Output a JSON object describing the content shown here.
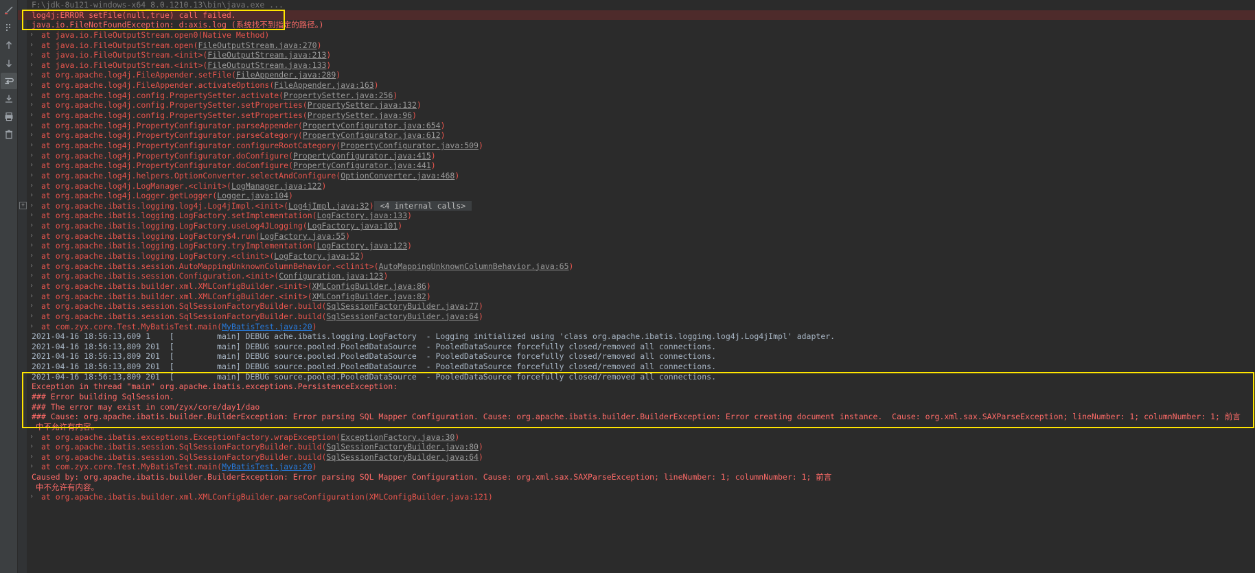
{
  "window": {
    "command_line": "F:\\jdk-8u121-windows-x64_8.0.1210.13\\bin\\java.exe ..."
  },
  "toolbar": {
    "items": [
      {
        "name": "rerun-icon",
        "label": "Rerun"
      },
      {
        "name": "more-options-icon",
        "label": "More"
      },
      {
        "name": "up-arrow-icon",
        "label": "Previous Occurrence"
      },
      {
        "name": "down-arrow-icon",
        "label": "Next Occurrence"
      },
      {
        "name": "soft-wrap-icon",
        "label": "Soft-Wrap"
      },
      {
        "name": "scroll-to-end-icon",
        "label": "Scroll to End"
      },
      {
        "name": "print-icon",
        "label": "Print"
      },
      {
        "name": "clear-all-icon",
        "label": "Clear All"
      }
    ]
  },
  "console": {
    "lines": [
      {
        "kind": "title",
        "text": "F:\\jdk-8u121-windows-x64_8.0.1210.13\\bin\\java.exe ..."
      },
      {
        "kind": "error-highlight",
        "text": "log4j:ERROR setFile(null,true) call failed."
      },
      {
        "kind": "error-plain",
        "text": "java.io.FileNotFoundException: d:axis.log (系统找不到指定的路径。)"
      },
      {
        "kind": "at",
        "text": "at java.io.FileOutputStream.open0(Native Method)"
      },
      {
        "kind": "at",
        "text": "at java.io.FileOutputStream.open(",
        "link": "FileOutputStream.java:270",
        "tail": ")"
      },
      {
        "kind": "at",
        "text": "at java.io.FileOutputStream.<init>(",
        "link": "FileOutputStream.java:213",
        "tail": ")"
      },
      {
        "kind": "at",
        "text": "at java.io.FileOutputStream.<init>(",
        "link": "FileOutputStream.java:133",
        "tail": ")"
      },
      {
        "kind": "at",
        "text": "at org.apache.log4j.FileAppender.setFile(",
        "link": "FileAppender.java:289",
        "tail": ")"
      },
      {
        "kind": "at",
        "text": "at org.apache.log4j.FileAppender.activateOptions(",
        "link": "FileAppender.java:163",
        "tail": ")"
      },
      {
        "kind": "at",
        "text": "at org.apache.log4j.config.PropertySetter.activate(",
        "link": "PropertySetter.java:256",
        "tail": ")"
      },
      {
        "kind": "at",
        "text": "at org.apache.log4j.config.PropertySetter.setProperties(",
        "link": "PropertySetter.java:132",
        "tail": ")"
      },
      {
        "kind": "at",
        "text": "at org.apache.log4j.config.PropertySetter.setProperties(",
        "link": "PropertySetter.java:96",
        "tail": ")"
      },
      {
        "kind": "at",
        "text": "at org.apache.log4j.PropertyConfigurator.parseAppender(",
        "link": "PropertyConfigurator.java:654",
        "tail": ")"
      },
      {
        "kind": "at",
        "text": "at org.apache.log4j.PropertyConfigurator.parseCategory(",
        "link": "PropertyConfigurator.java:612",
        "tail": ")"
      },
      {
        "kind": "at",
        "text": "at org.apache.log4j.PropertyConfigurator.configureRootCategory(",
        "link": "PropertyConfigurator.java:509",
        "tail": ")"
      },
      {
        "kind": "at",
        "text": "at org.apache.log4j.PropertyConfigurator.doConfigure(",
        "link": "PropertyConfigurator.java:415",
        "tail": ")"
      },
      {
        "kind": "at",
        "text": "at org.apache.log4j.PropertyConfigurator.doConfigure(",
        "link": "PropertyConfigurator.java:441",
        "tail": ")"
      },
      {
        "kind": "at",
        "text": "at org.apache.log4j.helpers.OptionConverter.selectAndConfigure(",
        "link": "OptionConverter.java:468",
        "tail": ")"
      },
      {
        "kind": "at",
        "text": "at org.apache.log4j.LogManager.<clinit>(",
        "link": "LogManager.java:122",
        "tail": ")"
      },
      {
        "kind": "at",
        "text": "at org.apache.log4j.Logger.getLogger(",
        "link": "Logger.java:104",
        "tail": ")"
      },
      {
        "kind": "at-expandable",
        "text": "at org.apache.ibatis.logging.log4j.Log4jImpl.<init>(",
        "link": "Log4jImpl.java:32",
        "tail": ")",
        "badge": "<4 internal calls>"
      },
      {
        "kind": "at",
        "text": "at org.apache.ibatis.logging.LogFactory.setImplementation(",
        "link": "LogFactory.java:133",
        "tail": ")"
      },
      {
        "kind": "at",
        "text": "at org.apache.ibatis.logging.LogFactory.useLog4JLogging(",
        "link": "LogFactory.java:101",
        "tail": ")"
      },
      {
        "kind": "at",
        "text": "at org.apache.ibatis.logging.LogFactory$4.run(",
        "link": "LogFactory.java:55",
        "tail": ")"
      },
      {
        "kind": "at",
        "text": "at org.apache.ibatis.logging.LogFactory.tryImplementation(",
        "link": "LogFactory.java:123",
        "tail": ")"
      },
      {
        "kind": "at",
        "text": "at org.apache.ibatis.logging.LogFactory.<clinit>(",
        "link": "LogFactory.java:52",
        "tail": ")"
      },
      {
        "kind": "at",
        "text": "at org.apache.ibatis.session.AutoMappingUnknownColumnBehavior.<clinit>(",
        "link": "AutoMappingUnknownColumnBehavior.java:65",
        "tail": ")"
      },
      {
        "kind": "at",
        "text": "at org.apache.ibatis.session.Configuration.<init>(",
        "link": "Configuration.java:123",
        "tail": ")"
      },
      {
        "kind": "at",
        "text": "at org.apache.ibatis.builder.xml.XMLConfigBuilder.<init>(",
        "link": "XMLConfigBuilder.java:86",
        "tail": ")"
      },
      {
        "kind": "at",
        "text": "at org.apache.ibatis.builder.xml.XMLConfigBuilder.<init>(",
        "link": "XMLConfigBuilder.java:82",
        "tail": ")"
      },
      {
        "kind": "at",
        "text": "at org.apache.ibatis.session.SqlSessionFactoryBuilder.build(",
        "link": "SqlSessionFactoryBuilder.java:77",
        "tail": ")"
      },
      {
        "kind": "at",
        "text": "at org.apache.ibatis.session.SqlSessionFactoryBuilder.build(",
        "link": "SqlSessionFactoryBuilder.java:64",
        "tail": ")"
      },
      {
        "kind": "at-blue",
        "text": "at com.zyx.core.Test.MyBatisTest.main(",
        "link": "MyBatisTest.java:20",
        "tail": ")"
      },
      {
        "kind": "debug",
        "text": "2021-04-16 18:56:13,609 1    [         main] DEBUG ache.ibatis.logging.LogFactory  - Logging initialized using 'class org.apache.ibatis.logging.log4j.Log4jImpl' adapter."
      },
      {
        "kind": "debug",
        "text": "2021-04-16 18:56:13,809 201  [         main] DEBUG source.pooled.PooledDataSource  - PooledDataSource forcefully closed/removed all connections."
      },
      {
        "kind": "debug",
        "text": "2021-04-16 18:56:13,809 201  [         main] DEBUG source.pooled.PooledDataSource  - PooledDataSource forcefully closed/removed all connections."
      },
      {
        "kind": "debug",
        "text": "2021-04-16 18:56:13,809 201  [         main] DEBUG source.pooled.PooledDataSource  - PooledDataSource forcefully closed/removed all connections."
      },
      {
        "kind": "debug",
        "text": "2021-04-16 18:56:13,809 201  [         main] DEBUG source.pooled.PooledDataSource  - PooledDataSource forcefully closed/removed all connections."
      },
      {
        "kind": "exc",
        "text": "Exception in thread \"main\" org.apache.ibatis.exceptions.PersistenceException:"
      },
      {
        "kind": "exc",
        "text": "### Error building SqlSession."
      },
      {
        "kind": "exc",
        "text": "### The error may exist in com/zyx/core/day1/dao"
      },
      {
        "kind": "exc",
        "text": "### Cause: org.apache.ibatis.builder.BuilderException: Error parsing SQL Mapper Configuration. Cause: org.apache.ibatis.builder.BuilderException: Error creating document instance.  Cause: org.xml.sax.SAXParseException; lineNumber: 1; columnNumber: 1; 前言"
      },
      {
        "kind": "exc-wrap",
        "text": "中不允许有内容。"
      },
      {
        "kind": "at",
        "text": "at org.apache.ibatis.exceptions.ExceptionFactory.wrapException(",
        "link": "ExceptionFactory.java:30",
        "tail": ")"
      },
      {
        "kind": "at",
        "text": "at org.apache.ibatis.session.SqlSessionFactoryBuilder.build(",
        "link": "SqlSessionFactoryBuilder.java:80",
        "tail": ")"
      },
      {
        "kind": "at",
        "text": "at org.apache.ibatis.session.SqlSessionFactoryBuilder.build(",
        "link": "SqlSessionFactoryBuilder.java:64",
        "tail": ")"
      },
      {
        "kind": "at-blue",
        "text": "at com.zyx.core.Test.MyBatisTest.main(",
        "link": "MyBatisTest.java:20",
        "tail": ")"
      },
      {
        "kind": "caused",
        "text": "Caused by: org.apache.ibatis.builder.BuilderException: Error parsing SQL Mapper Configuration. Cause: org.xml.sax.SAXParseException; lineNumber: 1; columnNumber: 1; 前言"
      },
      {
        "kind": "caused-wrap",
        "text": "中不允许有内容。"
      },
      {
        "kind": "at-cut",
        "text": "at org.apache.ibatis.builder.xml.XMLConfigBuilder.parseConfiguration(XMLConfigBuilder.java:121)"
      }
    ]
  },
  "colors": {
    "background": "#2b2b2b",
    "gutter": "#313335",
    "toolbar": "#3c3f41",
    "error_text": "#ff6b68",
    "stack_text": "#e8554d",
    "error_row_bg": "#4e2b2b",
    "highlight_border": "#ffe500",
    "debug_text": "#a9b7c6",
    "link": "#9b9b9b",
    "blue_link": "#287bde"
  }
}
